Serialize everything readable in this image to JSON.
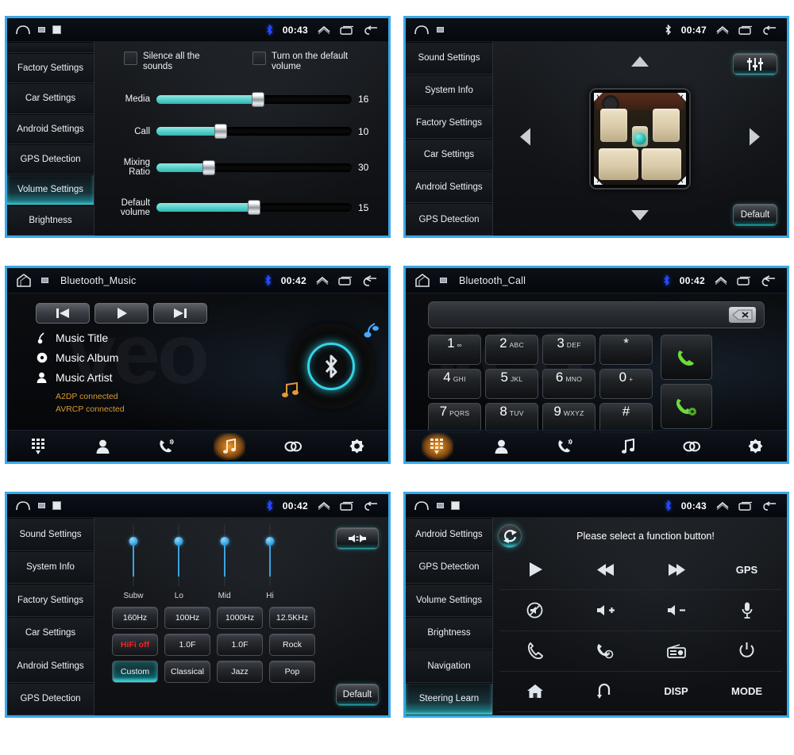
{
  "panels": {
    "volume_settings": {
      "status": {
        "time": "00:43",
        "bt_icon": "bluetooth-icon",
        "home_icon": "home-icon"
      },
      "sidebar": [
        {
          "label": "",
          "selected": false,
          "partial": true
        },
        {
          "label": "Factory Settings",
          "selected": false
        },
        {
          "label": "Car Settings",
          "selected": false
        },
        {
          "label": "Android Settings",
          "selected": false
        },
        {
          "label": "GPS Detection",
          "selected": false
        },
        {
          "label": "Volume Settings",
          "selected": true
        },
        {
          "label": "Brightness",
          "selected": false
        }
      ],
      "checkboxes": [
        {
          "label": "Silence all the sounds",
          "checked": false
        },
        {
          "label": "Turn on the default volume",
          "checked": false
        }
      ],
      "sliders": [
        {
          "name": "Media",
          "value": "16",
          "percent": 52
        },
        {
          "name": "Call",
          "value": "10",
          "percent": 33
        },
        {
          "name": "Mixing Ratio",
          "value": "30",
          "percent": 27
        },
        {
          "name": "Default volume",
          "value": "15",
          "percent": 50
        }
      ]
    },
    "car_settings": {
      "status": {
        "time": "00:47"
      },
      "sidebar": [
        {
          "label": "Sound Settings",
          "selected": false
        },
        {
          "label": "System Info",
          "selected": false
        },
        {
          "label": "Factory Settings",
          "selected": false
        },
        {
          "label": "Car Settings",
          "selected": false
        },
        {
          "label": "Android Settings",
          "selected": false
        },
        {
          "label": "GPS Detection",
          "selected": false
        }
      ],
      "eq_button_label": "",
      "default_button_label": "Default",
      "arrows": [
        "up",
        "down",
        "left",
        "right"
      ]
    },
    "bluetooth_music": {
      "status": {
        "title": "Bluetooth_Music",
        "time": "00:42"
      },
      "transport": [
        "prev",
        "play",
        "next"
      ],
      "meta": [
        {
          "icon": "note-icon",
          "label": "Music Title"
        },
        {
          "icon": "disc-icon",
          "label": "Music Album"
        },
        {
          "icon": "person-icon",
          "label": "Music Artist"
        }
      ],
      "connections": [
        "A2DP connected",
        "AVRCP connected"
      ],
      "watermark": "veo",
      "nav": [
        {
          "name": "keypad",
          "active": false
        },
        {
          "name": "contacts",
          "active": false
        },
        {
          "name": "call-history",
          "active": false
        },
        {
          "name": "music",
          "active": true
        },
        {
          "name": "link",
          "active": false
        },
        {
          "name": "settings",
          "active": false
        }
      ]
    },
    "bluetooth_call": {
      "status": {
        "title": "Bluetooth_Call",
        "time": "00:42"
      },
      "number_value": "",
      "delete_label": "✕",
      "keys": [
        {
          "digit": "1",
          "sub": "∞"
        },
        {
          "digit": "2",
          "sub": "ABC"
        },
        {
          "digit": "3",
          "sub": "DEF"
        },
        {
          "digit": "*",
          "sub": ""
        },
        {
          "digit": "4",
          "sub": "GHI"
        },
        {
          "digit": "5",
          "sub": "JKL"
        },
        {
          "digit": "6",
          "sub": "MNO"
        },
        {
          "digit": "0",
          "sub": "+"
        },
        {
          "digit": "7",
          "sub": "PQRS"
        },
        {
          "digit": "8",
          "sub": "TUV"
        },
        {
          "digit": "9",
          "sub": "WXYZ"
        },
        {
          "digit": "#",
          "sub": ""
        }
      ],
      "call_buttons": [
        "dial",
        "hangup"
      ],
      "nav": [
        {
          "name": "keypad",
          "active": true
        },
        {
          "name": "contacts",
          "active": false
        },
        {
          "name": "call-history",
          "active": false
        },
        {
          "name": "music",
          "active": false
        },
        {
          "name": "link",
          "active": false
        },
        {
          "name": "settings",
          "active": false
        }
      ]
    },
    "equalizer": {
      "status": {
        "time": "00:42"
      },
      "sidebar": [
        {
          "label": "Sound Settings",
          "selected": false
        },
        {
          "label": "System Info",
          "selected": false
        },
        {
          "label": "Factory Settings",
          "selected": false
        },
        {
          "label": "Car Settings",
          "selected": false
        },
        {
          "label": "Android Settings",
          "selected": false
        },
        {
          "label": "GPS Detection",
          "selected": false
        }
      ],
      "bands": [
        {
          "label": "Subw",
          "pos": 14
        },
        {
          "label": "Lo",
          "pos": 14
        },
        {
          "label": "Mid",
          "pos": 14
        },
        {
          "label": "Hi",
          "pos": 14
        }
      ],
      "freq_row": [
        "160Hz",
        "100Hz",
        "1000Hz",
        "12.5KHz"
      ],
      "gain_row": [
        "HiFi off",
        "1.0F",
        "1.0F",
        "Rock"
      ],
      "preset_row": [
        "Custom",
        "Classical",
        "Jazz",
        "Pop"
      ],
      "selected_preset": "Custom",
      "hifi_state_color": "#ff1f1f",
      "default_button_label": "Default"
    },
    "steering_learn": {
      "status": {
        "time": "00:43"
      },
      "sidebar": [
        {
          "label": "Android Settings",
          "selected": false
        },
        {
          "label": "GPS Detection",
          "selected": false
        },
        {
          "label": "Volume Settings",
          "selected": false
        },
        {
          "label": "Brightness",
          "selected": false
        },
        {
          "label": "Navigation",
          "selected": false
        },
        {
          "label": "Steering Learn",
          "selected": true
        }
      ],
      "message": "Please select a function button!",
      "functions": [
        {
          "name": "play-icon",
          "label": ""
        },
        {
          "name": "previous-track-icon",
          "label": ""
        },
        {
          "name": "next-track-icon",
          "label": ""
        },
        {
          "name": "gps-label",
          "label": "GPS"
        },
        {
          "name": "mute-icon",
          "label": ""
        },
        {
          "name": "volume-up-icon",
          "label": ""
        },
        {
          "name": "volume-down-icon",
          "label": ""
        },
        {
          "name": "mic-icon",
          "label": ""
        },
        {
          "name": "phone-answer-icon",
          "label": ""
        },
        {
          "name": "phone-hangup-icon",
          "label": ""
        },
        {
          "name": "radio-icon",
          "label": ""
        },
        {
          "name": "power-icon",
          "label": ""
        },
        {
          "name": "home-icon",
          "label": ""
        },
        {
          "name": "back-icon",
          "label": ""
        },
        {
          "name": "disp-label",
          "label": "DISP"
        },
        {
          "name": "mode-label",
          "label": "MODE"
        }
      ]
    }
  },
  "colors": {
    "accent_cyan": "#2fd2da",
    "accent_blue": "#3aa3e0",
    "frame_blue": "#3aa8e8",
    "amber": "#d99a2e",
    "red": "#ff1f1f",
    "orange_glow": "#ffa028"
  }
}
